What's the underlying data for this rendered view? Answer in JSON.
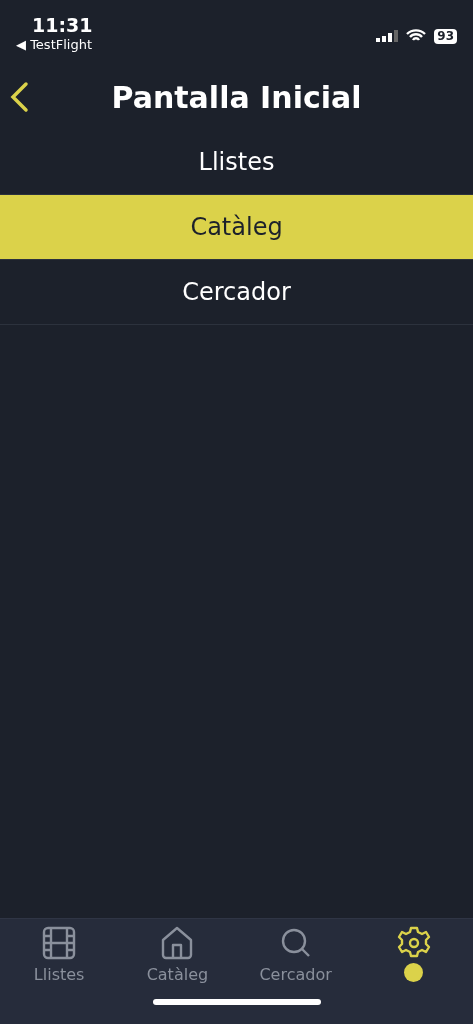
{
  "status_bar": {
    "time": "11:31",
    "back_app": "◀ TestFlight",
    "battery": "93"
  },
  "header": {
    "title": "Pantalla Inicial"
  },
  "options": [
    {
      "label": "Llistes",
      "selected": false
    },
    {
      "label": "Catàleg",
      "selected": true
    },
    {
      "label": "Cercador",
      "selected": false
    }
  ],
  "tabs": [
    {
      "kind": "film",
      "label": "Llistes",
      "selected": false
    },
    {
      "kind": "home",
      "label": "Catàleg",
      "selected": false
    },
    {
      "kind": "search",
      "label": "Cercador",
      "selected": false
    },
    {
      "kind": "gear",
      "selected": true
    }
  ]
}
